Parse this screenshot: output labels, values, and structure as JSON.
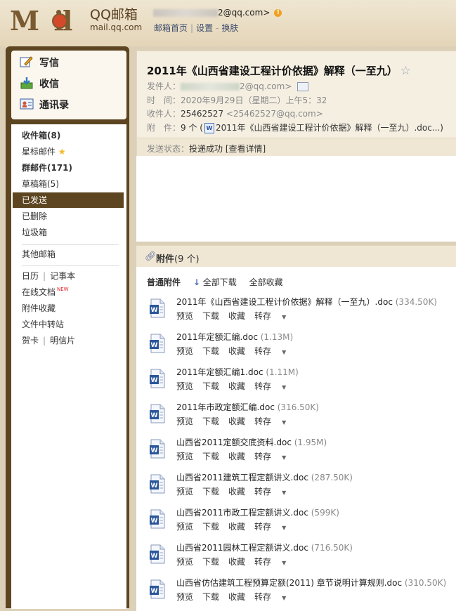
{
  "header": {
    "brand_cn": "QQ邮箱",
    "brand_en": "mail.qq.com",
    "account_suffix": "2@qq.com>",
    "links": [
      "邮箱首页",
      "设置",
      "换肤"
    ]
  },
  "quick": {
    "compose": "写信",
    "receive": "收信",
    "contacts": "通讯录"
  },
  "folders": {
    "inbox": "收件箱(8)",
    "starred": "星标邮件",
    "group": "群邮件(171)",
    "drafts": "草稿箱(5)",
    "sent": "已发送",
    "deleted": "已删除",
    "spam": "垃圾箱",
    "other": "其他邮箱",
    "calendar": "日历",
    "notes": "记事本",
    "docs": "在线文档",
    "new_badge": "NEW",
    "att_fav": "附件收藏",
    "transfer": "文件中转站",
    "card": "贺卡",
    "postcard": "明信片"
  },
  "mail": {
    "subject": "2011年《山西省建设工程计价依据》解释（一至九）",
    "from_label": "发件人：",
    "from_value": "2@qq.com>",
    "time_label": "时　间：",
    "time_value": "2020年9月29日（星期二）上午5：32",
    "to_label": "收件人：",
    "to_name": "25462527",
    "to_addr": "<25462527@qq.com>",
    "att_label": "附　件：",
    "att_count": "9 个 (",
    "att_first": "2011年《山西省建设工程计价依据》解释（一至九）.doc...)",
    "status_label": "发送状态：",
    "status_value": "投递成功",
    "status_link": "[查看详情]"
  },
  "attachments": {
    "bar_title": "附件",
    "bar_count": "(9 个)",
    "tool_label": "普通附件",
    "tool_download_all": "全部下载",
    "tool_save_all": "全部收藏",
    "ops": [
      "预览",
      "下载",
      "收藏",
      "转存"
    ],
    "files": [
      {
        "name": "2011年《山西省建设工程计价依据》解释（一至九）.doc",
        "size": "(334.50K)"
      },
      {
        "name": "2011年定额汇编.doc",
        "size": "(1.13M)"
      },
      {
        "name": "2011年定额汇编1.doc",
        "size": "(1.11M)"
      },
      {
        "name": "2011年市政定额汇编.doc",
        "size": "(316.50K)"
      },
      {
        "name": "山西省2011定额交底资料.doc",
        "size": "(1.95M)"
      },
      {
        "name": "山西省2011建筑工程定额讲义.doc",
        "size": "(287.50K)"
      },
      {
        "name": "山西省2011市政工程定额讲义.doc",
        "size": "(599K)"
      },
      {
        "name": "山西省2011园林工程定额讲义.doc",
        "size": "(716.50K)"
      },
      {
        "name": "山西省仿估建筑工程预算定额(2011) 章节说明计算规则.doc",
        "size": "(310.50K)"
      }
    ]
  }
}
